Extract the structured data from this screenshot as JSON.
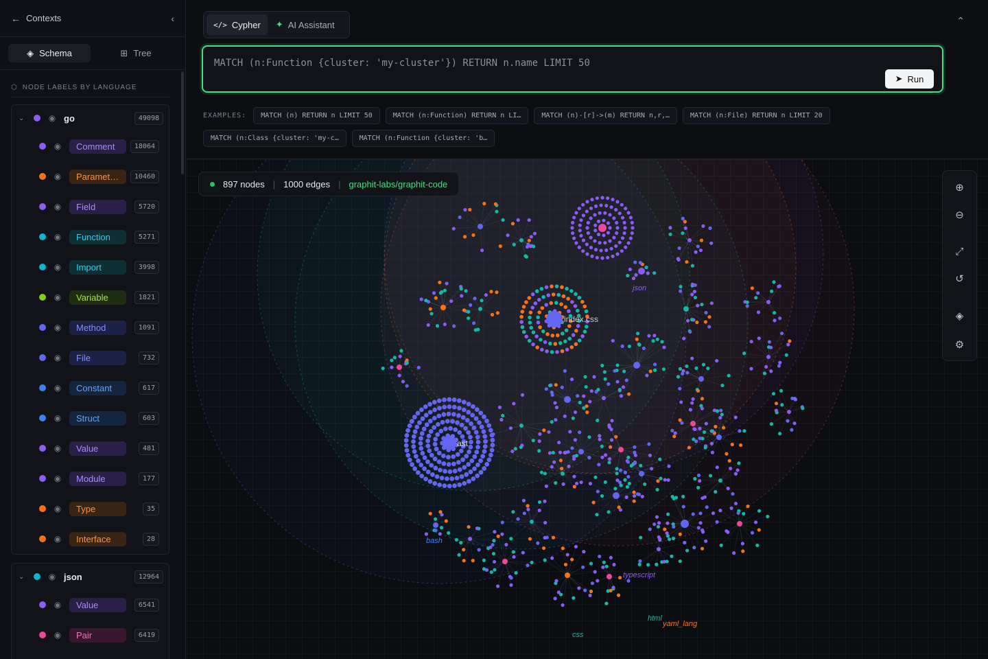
{
  "sidebar": {
    "back_label": "Contexts",
    "tabs": [
      {
        "label": "Schema",
        "active": true,
        "icon": "layers-icon"
      },
      {
        "label": "Tree",
        "active": false,
        "icon": "tree-icon"
      }
    ],
    "section_title": "NODE LABELS BY LANGUAGE",
    "groups": [
      {
        "name": "go",
        "count": "49098",
        "color": "#8b5cf6",
        "items": [
          {
            "label": "Comment",
            "count": "18064",
            "color": "#8b5cf6",
            "text": "#a78bfa",
            "bg": "#2a1f47"
          },
          {
            "label": "Paramet…",
            "count": "10460",
            "color": "#f97316",
            "text": "#fb923c",
            "bg": "#3a2414"
          },
          {
            "label": "Field",
            "count": "5720",
            "color": "#8b5cf6",
            "text": "#a78bfa",
            "bg": "#2a1f47"
          },
          {
            "label": "Function",
            "count": "5271",
            "color": "#06b6d4",
            "text": "#22d3ee",
            "bg": "#0f2f36"
          },
          {
            "label": "Import",
            "count": "3998",
            "color": "#06b6d4",
            "text": "#22d3ee",
            "bg": "#0f2f36"
          },
          {
            "label": "Variable",
            "count": "1821",
            "color": "#84cc16",
            "text": "#a3e635",
            "bg": "#1f2e12"
          },
          {
            "label": "Method",
            "count": "1091",
            "color": "#6366f1",
            "text": "#818cf8",
            "bg": "#1e2146"
          },
          {
            "label": "File",
            "count": "732",
            "color": "#6366f1",
            "text": "#818cf8",
            "bg": "#1e2146"
          },
          {
            "label": "Constant",
            "count": "617",
            "color": "#3b82f6",
            "text": "#60a5fa",
            "bg": "#14253f"
          },
          {
            "label": "Struct",
            "count": "603",
            "color": "#3b82f6",
            "text": "#60a5fa",
            "bg": "#14253f"
          },
          {
            "label": "Value",
            "count": "481",
            "color": "#8b5cf6",
            "text": "#a78bfa",
            "bg": "#2a1f47"
          },
          {
            "label": "Module",
            "count": "177",
            "color": "#8b5cf6",
            "text": "#a78bfa",
            "bg": "#2a1f47"
          },
          {
            "label": "Type",
            "count": "35",
            "color": "#f97316",
            "text": "#fb923c",
            "bg": "#3a2414"
          },
          {
            "label": "Interface",
            "count": "28",
            "color": "#f97316",
            "text": "#fb923c",
            "bg": "#3a2414"
          }
        ]
      },
      {
        "name": "json",
        "count": "12964",
        "color": "#06b6d4",
        "items": [
          {
            "label": "Value",
            "count": "6541",
            "color": "#8b5cf6",
            "text": "#a78bfa",
            "bg": "#2a1f47"
          },
          {
            "label": "Pair",
            "count": "6419",
            "color": "#ec4899",
            "text": "#f472b6",
            "bg": "#3a1630"
          },
          {
            "label": "",
            "count": "",
            "color": "#3b82f6",
            "text": "#60a5fa",
            "bg": "#14253f"
          }
        ]
      }
    ]
  },
  "main": {
    "mode_tabs": [
      {
        "label": "Cypher",
        "icon": "code-icon",
        "active": true
      },
      {
        "label": "AI Assistant",
        "icon": "sparkle-icon",
        "active": false
      }
    ],
    "query": "MATCH (n:Function {cluster: 'my-cluster'}) RETURN n.name LIMIT 50",
    "run_label": "Run",
    "examples_label": "EXAMPLES:",
    "examples": [
      "MATCH (n) RETURN n LIMIT 50",
      "MATCH (n:Function) RETURN n LI…",
      "MATCH (n)-[r]->(m) RETURN n,r,…",
      "MATCH (n:File) RETURN n LIMIT 20",
      "MATCH (n:Class {cluster: 'my-c…",
      "MATCH (n:Function {cluster: 'b…"
    ]
  },
  "graph": {
    "nodes_text": "897 nodes",
    "edges_text": "1000 edges",
    "repo": "graphit-labs/graphit-code",
    "labels": [
      {
        "text": "index.css",
        "color": "#c9cdd6"
      },
      {
        "text": "ast",
        "color": "#e2e4ea"
      },
      {
        "text": "json",
        "color": "#8b5cf6"
      },
      {
        "text": "bash",
        "color": "#3b82f6"
      },
      {
        "text": "typescript",
        "color": "#8b5cf6"
      },
      {
        "text": "html",
        "color": "#14b8a6"
      },
      {
        "text": "yaml_lang",
        "color": "#f97316"
      },
      {
        "text": "css",
        "color": "#14b8a6"
      }
    ],
    "tools": [
      "zoom-in-icon",
      "zoom-out-icon",
      "fit-icon",
      "reset-icon",
      "layers-icon",
      "settings-icon"
    ],
    "palette": [
      "#8b5cf6",
      "#14b8a6",
      "#f97316",
      "#ec4899",
      "#6366f1",
      "#3b82f6"
    ]
  }
}
